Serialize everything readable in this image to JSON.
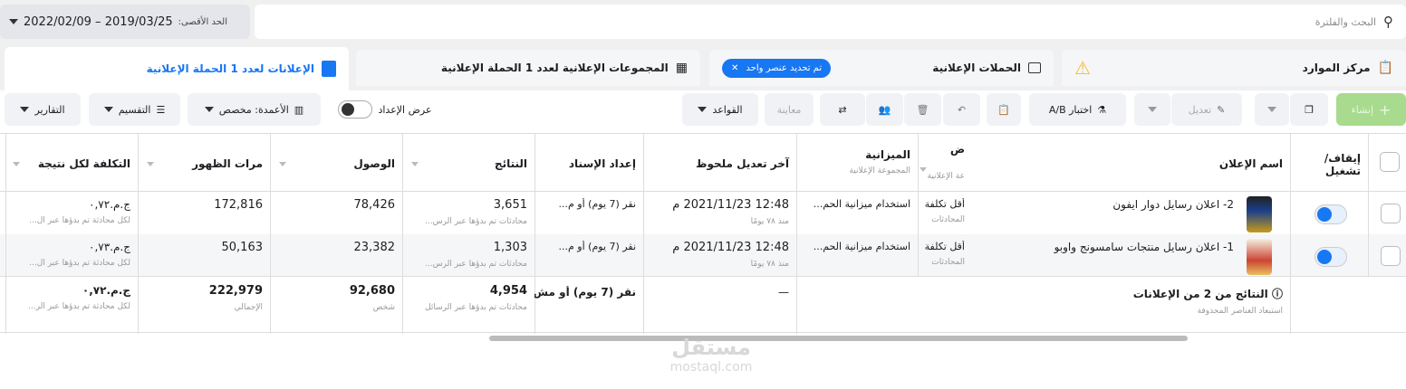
{
  "top": {
    "search_placeholder": "البحث والفلترة",
    "date_label": "الحد الأقصى:",
    "date_range": "2022/02/09 – 2019/03/25"
  },
  "tabs": {
    "resource_center": "مركز الموارد",
    "campaigns": "الحملات الإعلانية",
    "selected_pill": "تم تحديد عنصر واحد",
    "adsets": "المجموعات الإعلانية لعدد 1 الحملة الإعلانية",
    "ads": "الإعلانات لعدد 1 الحملة الإعلانية"
  },
  "toolbar": {
    "create": "إنشاء",
    "edit": "تعديل",
    "ab_test": "اختبار A/B",
    "preview": "معاينة",
    "rules": "القواعد",
    "view_setup": "عرض الإعداد",
    "columns": "الأعمدة: مخصص",
    "breakdown": "التقسيم",
    "reports": "التقارير"
  },
  "headers": {
    "toggle": "إيقاف/ تشغيل",
    "name": "اسم الإعلان",
    "bid": "ض",
    "bid_sub": "عة الإعلانية",
    "budget": "الميزانية",
    "budget_sub": "المجموعة الإعلانية",
    "last_edit": "آخر تعديل ملحوظ",
    "attribution": "إعداد الإسناد",
    "results": "النتائج",
    "reach": "الوصول",
    "impressions": "مرات الظهور",
    "cost": "التكلفة لكل نتيجة"
  },
  "rows": [
    {
      "name": "2- اعلان رسايل دوار ايفون",
      "bid": "أقل تكلفة",
      "bid_sub": "المحادثات",
      "budget": "استخدام ميزانية الحم...",
      "last_edit": "12:48 2021/11/23 م",
      "last_edit_sub": "منذ ٧٨ يومًا",
      "attribution": "نقر (7 يوم) أو م...",
      "results": "3,651",
      "results_sub": "محادثات تم بدؤها عبر الرس...",
      "reach": "78,426",
      "impressions": "172,816",
      "cost": "ج.م.٠,٧٢",
      "cost_sub": "لكل محادثة تم بدؤها عبر ال..."
    },
    {
      "name": "1- اعلان رسايل منتجات سامسونج واوبو",
      "bid": "أقل تكلفة",
      "bid_sub": "المحادثات",
      "budget": "استخدام ميزانية الحم...",
      "last_edit": "12:48 2021/11/23 م",
      "last_edit_sub": "منذ ٧٨ يومًا",
      "attribution": "نقر (7 يوم) أو م...",
      "results": "1,303",
      "results_sub": "محادثات تم بدؤها عبر الرس...",
      "reach": "23,382",
      "impressions": "50,163",
      "cost": "ج.م.٠,٧٣",
      "cost_sub": "لكل محادثة تم بدؤها عبر ال..."
    }
  ],
  "totals": {
    "title": "النتائج من 2 من الإعلانات",
    "sub": "استبعاد العناصر المحذوفة",
    "last_edit": "—",
    "attribution": "نقر (7 يوم) أو مش...",
    "results": "4,954",
    "results_sub": "محادثات تم بدؤها عبر الرسائل",
    "reach": "92,680",
    "reach_sub": "شخص",
    "impressions": "222,979",
    "impressions_sub": "الإجمالي",
    "cost": "ج.م.٠,٧٢",
    "cost_sub": "لكل محادثة تم بدؤها عبر الر..."
  },
  "watermark": {
    "arabic": "مستقل",
    "latin": "mostaql.com"
  }
}
